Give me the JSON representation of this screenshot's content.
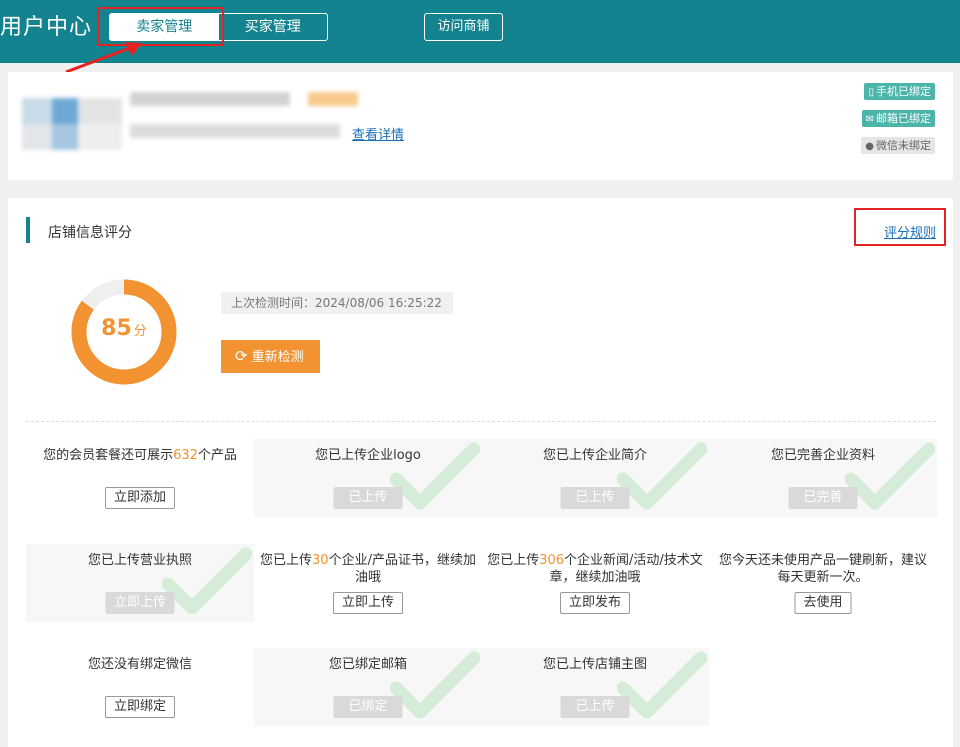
{
  "header": {
    "title": "用户中心",
    "tabs": [
      {
        "label": "卖家管理",
        "active": true
      },
      {
        "label": "买家管理",
        "active": false
      }
    ],
    "visit_button": "访问商铺",
    "accent_color": "#13838f"
  },
  "profile": {
    "detail_link": "查看详情",
    "bindings": [
      {
        "label": "手机已绑定",
        "status": "bound",
        "icon": "phone-icon"
      },
      {
        "label": "邮箱已绑定",
        "status": "bound",
        "icon": "mail-icon"
      },
      {
        "label": "微信未绑定",
        "status": "unbound",
        "icon": "wechat-icon"
      }
    ]
  },
  "score_section": {
    "title": "店铺信息评分",
    "rule_link": "评分规则",
    "score": "85",
    "score_unit": "分",
    "score_percent": 85,
    "last_check_label": "上次检测时间：",
    "last_check_time": "2024/08/06 16:25:22",
    "recheck_button": "重新检测",
    "score_color": "#f39230"
  },
  "tasks": [
    {
      "pre": "您的会员套餐还可展示",
      "num": "632",
      "post": "个产品",
      "button": "立即添加",
      "done": false
    },
    {
      "pre": "您已上传企业logo",
      "num": "",
      "post": "",
      "button": "已上传",
      "done": true
    },
    {
      "pre": "您已上传企业简介",
      "num": "",
      "post": "",
      "button": "已上传",
      "done": true
    },
    {
      "pre": "您已完善企业资料",
      "num": "",
      "post": "",
      "button": "已完善",
      "done": true
    },
    {
      "pre": "您已上传营业执照",
      "num": "",
      "post": "",
      "button": "立即上传",
      "done": true
    },
    {
      "pre": "您已上传",
      "num": "30",
      "post": "个企业/产品证书，继续加油哦",
      "button": "立即上传",
      "done": false
    },
    {
      "pre": "您已上传",
      "num": "306",
      "post": "个企业新闻/活动/技术文章，继续加油哦",
      "button": "立即发布",
      "done": false
    },
    {
      "pre": "您今天还未使用产品一键刷新，建议每天更新一次。",
      "num": "",
      "post": "",
      "button": "去使用",
      "done": false
    },
    {
      "pre": "您还没有绑定微信",
      "num": "",
      "post": "",
      "button": "立即绑定",
      "done": false
    },
    {
      "pre": "您已绑定邮箱",
      "num": "",
      "post": "",
      "button": "已绑定",
      "done": true
    },
    {
      "pre": "您已上传店铺主图",
      "num": "",
      "post": "",
      "button": "已上传",
      "done": true
    }
  ]
}
